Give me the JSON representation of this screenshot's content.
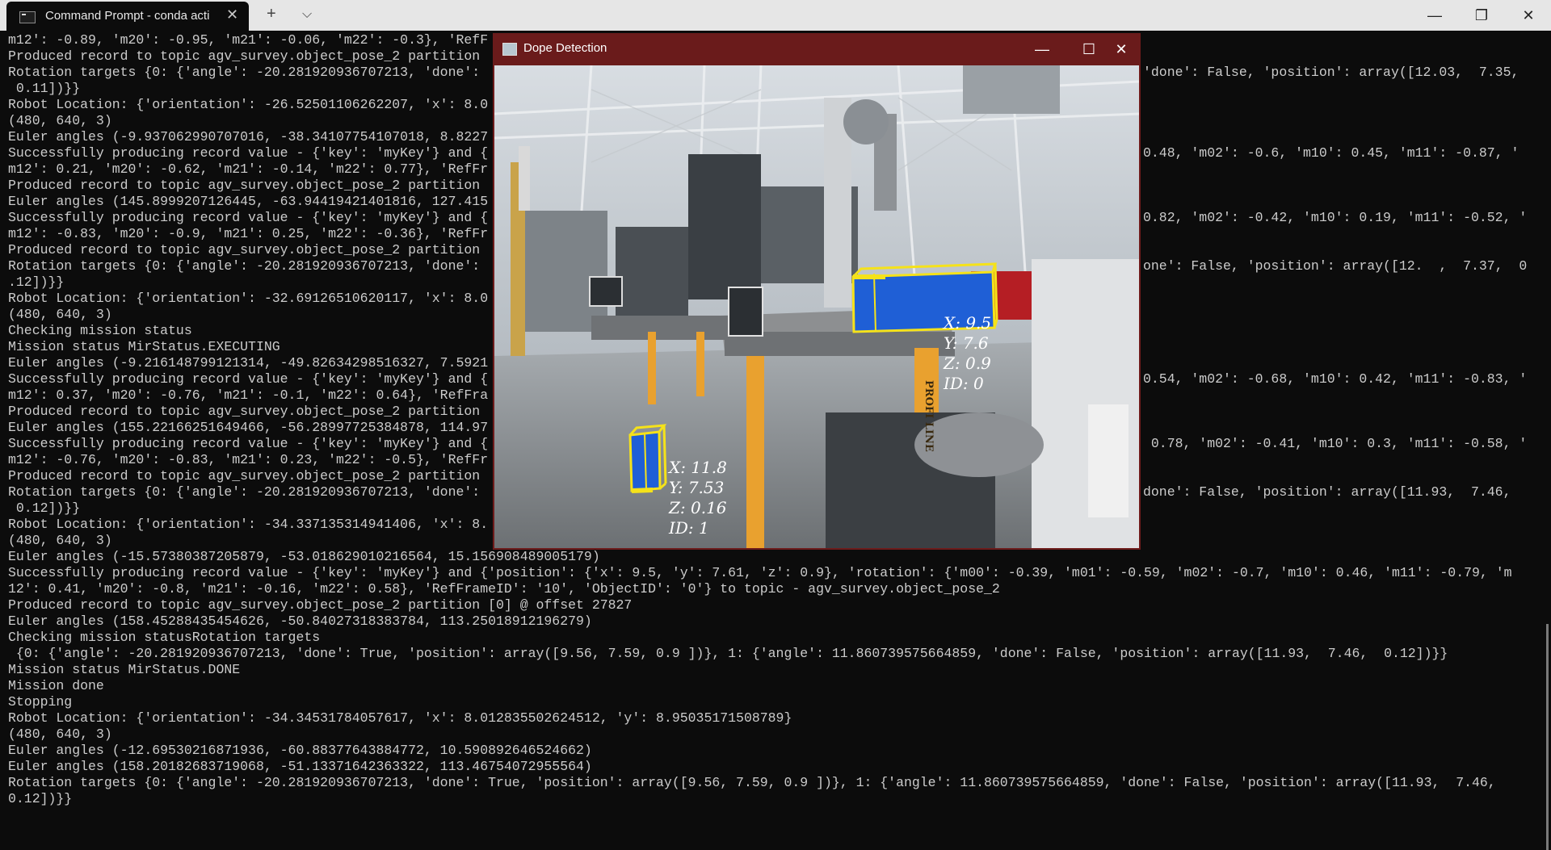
{
  "terminal": {
    "tab_title": "Command Prompt - conda  acti",
    "new_tab": "+",
    "dropdown": "⌵",
    "min": "—",
    "max": "❐",
    "close": "✕",
    "lines": [
      "m12': -0.89, 'm20': -0.95, 'm21': -0.06, 'm22': -0.3}, 'RefF",
      "Produced record to topic agv_survey.object_pose_2 partition",
      "Rotation targets {0: {'angle': -20.281920936707213, 'done':",
      " 0.11])}}",
      "Robot Location: {'orientation': -26.52501106262207, 'x': 8.0",
      "(480, 640, 3)",
      "Euler angles (-9.937062990707016, -38.34107754107018, 8.8227",
      "Successfully producing record value - {'key': 'myKey'} and {",
      "m12': 0.21, 'm20': -0.62, 'm21': -0.14, 'm22': 0.77}, 'RefFr",
      "Produced record to topic agv_survey.object_pose_2 partition",
      "Euler angles (145.8999207126445, -63.94419421401816, 127.415",
      "Successfully producing record value - {'key': 'myKey'} and {",
      "m12': -0.83, 'm20': -0.9, 'm21': 0.25, 'm22': -0.36}, 'RefFr",
      "Produced record to topic agv_survey.object_pose_2 partition",
      "Rotation targets {0: {'angle': -20.281920936707213, 'done':",
      ".12])}}",
      "Robot Location: {'orientation': -32.69126510620117, 'x': 8.0",
      "(480, 640, 3)",
      "Checking mission status",
      "Mission status MirStatus.EXECUTING",
      "Euler angles (-9.216148799121314, -49.82634298516327, 7.5921",
      "Successfully producing record value - {'key': 'myKey'} and {",
      "m12': 0.37, 'm20': -0.76, 'm21': -0.1, 'm22': 0.64}, 'RefFra",
      "Produced record to topic agv_survey.object_pose_2 partition",
      "Euler angles (155.22166251649466, -56.28997725384878, 114.97",
      "Successfully producing record value - {'key': 'myKey'} and {",
      "m12': -0.76, 'm20': -0.83, 'm21': 0.23, 'm22': -0.5}, 'RefFr",
      "Produced record to topic agv_survey.object_pose_2 partition",
      "Rotation targets {0: {'angle': -20.281920936707213, 'done':",
      " 0.12])}}",
      "Robot Location: {'orientation': -34.337135314941406, 'x': 8.",
      "(480, 640, 3)",
      "Euler angles (-15.57380387205879, -53.018629010216564, 15.156908489005179)",
      "Successfully producing record value - {'key': 'myKey'} and {'position': {'x': 9.5, 'y': 7.61, 'z': 0.9}, 'rotation': {'m00': -0.39, 'm01': -0.59, 'm02': -0.7, 'm10': 0.46, 'm11': -0.79, 'm",
      "12': 0.41, 'm20': -0.8, 'm21': -0.16, 'm22': 0.58}, 'RefFrameID': '10', 'ObjectID': '0'} to topic - agv_survey.object_pose_2",
      "Produced record to topic agv_survey.object_pose_2 partition [0] @ offset 27827",
      "Euler angles (158.45288435454626, -50.84027318383784, 113.25018912196279)",
      "Checking mission statusRotation targets",
      " {0: {'angle': -20.281920936707213, 'done': True, 'position': array([9.56, 7.59, 0.9 ])}, 1: {'angle': 11.860739575664859, 'done': False, 'position': array([11.93,  7.46,  0.12])}}",
      "Mission status MirStatus.DONE",
      "Mission done",
      "Stopping",
      "Robot Location: {'orientation': -34.34531784057617, 'x': 8.012835502624512, 'y': 8.95035171508789}",
      "(480, 640, 3)",
      "Euler angles (-12.69530216871936, -60.88377643884772, 10.590892646524662)",
      "Euler angles (158.20182683719068, -51.13371642363322, 113.46754072955564)",
      "Rotation targets {0: {'angle': -20.281920936707213, 'done': True, 'position': array([9.56, 7.59, 0.9 ])}, 1: {'angle': 11.860739575664859, 'done': False, 'position': array([11.93,  7.46,",
      "0.12])}}"
    ],
    "right_fragments": [
      "'done': False, 'position': array([12.03,  7.35,",
      "0.48, 'm02': -0.6, 'm10': 0.45, 'm11': -0.87, '",
      "0.82, 'm02': -0.42, 'm10': 0.19, 'm11': -0.52, '",
      "one': False, 'position': array([12.  ,  7.37,  0",
      "0.54, 'm02': -0.68, 'm10': 0.42, 'm11': -0.83, '",
      " 0.78, 'm02': -0.41, 'm10': 0.3, 'm11': -0.58, '",
      "done': False, 'position': array([11.93,  7.46,"
    ]
  },
  "dope": {
    "title": "Dope Detection",
    "min": "—",
    "max": "☐",
    "close": "✕",
    "detections": [
      {
        "x": "X: 9.5",
        "y": "Y: 7.6",
        "z": "Z: 0.9",
        "id": "ID: 0"
      },
      {
        "x": "X: 11.8",
        "y": "Y: 7.53",
        "z": "Z: 0.16",
        "id": "ID: 1"
      }
    ],
    "signage": "PROFI LINE"
  }
}
